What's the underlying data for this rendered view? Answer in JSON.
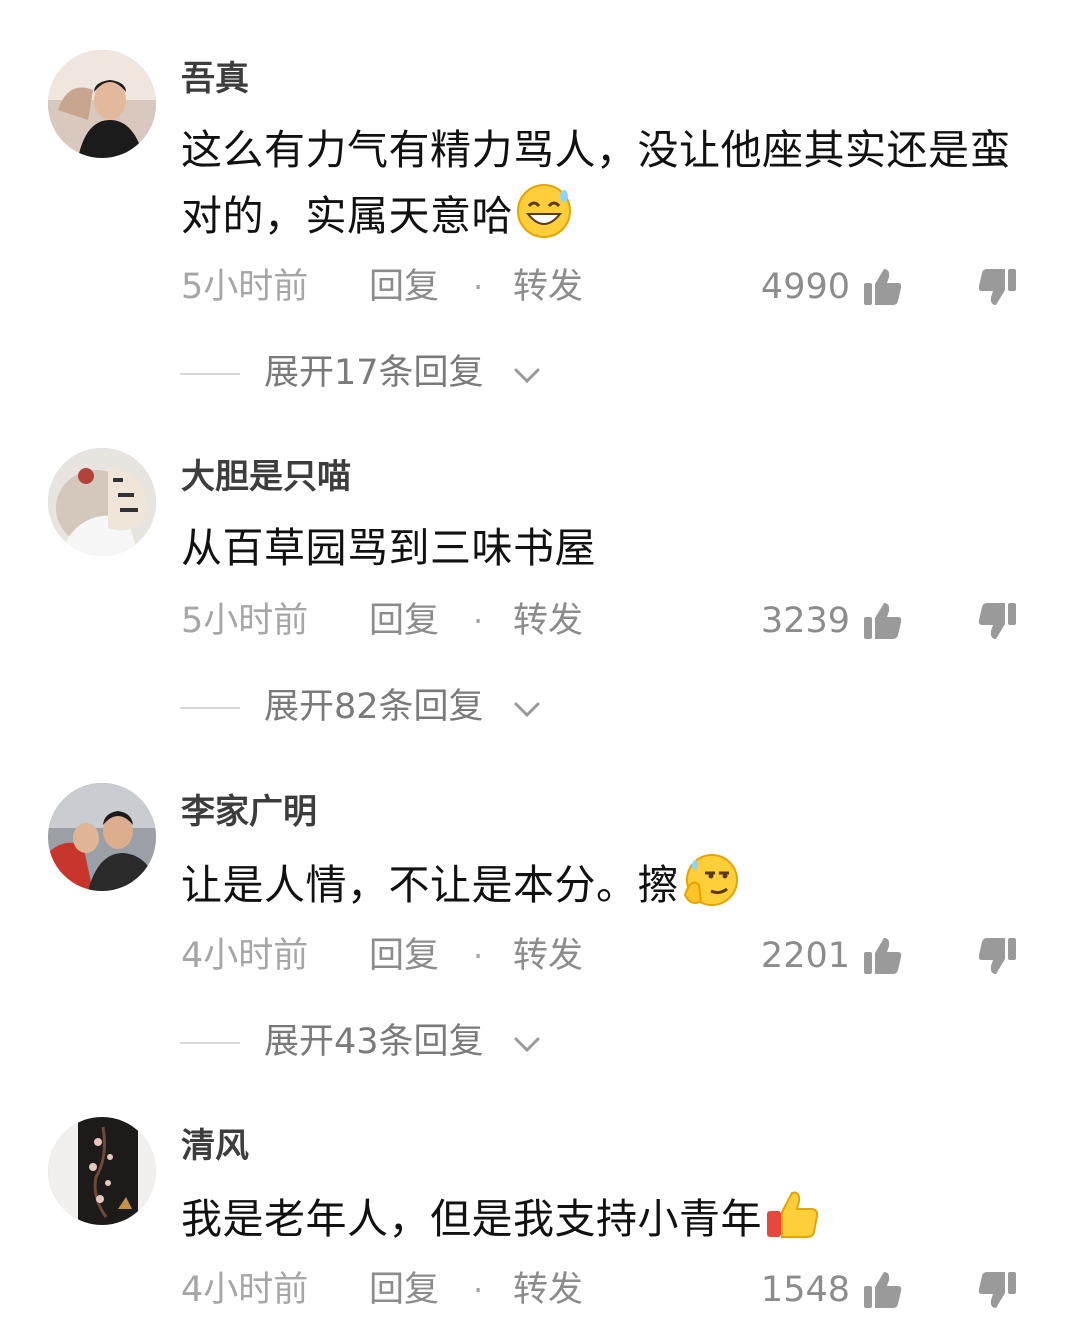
{
  "comments": [
    {
      "username": "吾真",
      "text": "这么有力气有精力骂人，没让他座其实还是蛮对的，实属天意哈",
      "emoji": "grinning-sweat-emoji",
      "time": "5小时前",
      "reply_label": "回复",
      "separator": "·",
      "share_label": "转发",
      "likes": "4990",
      "expand_label": "展开17条回复"
    },
    {
      "username": "大胆是只喵",
      "text": "从百草园骂到三味书屋",
      "emoji": "",
      "time": "5小时前",
      "reply_label": "回复",
      "separator": "·",
      "share_label": "转发",
      "likes": "3239",
      "expand_label": "展开82条回复"
    },
    {
      "username": "李家广明",
      "text": "让是人情，不让是本分。擦",
      "emoji": "smirk-wipe-emoji",
      "time": "4小时前",
      "reply_label": "回复",
      "separator": "·",
      "share_label": "转发",
      "likes": "2201",
      "expand_label": "展开43条回复"
    },
    {
      "username": "清风",
      "text": "我是老年人，但是我支持小青年",
      "emoji": "thumbs-up-emoji",
      "time": "4小时前",
      "reply_label": "回复",
      "separator": "·",
      "share_label": "转发",
      "likes": "1548",
      "expand_label": ""
    }
  ],
  "icons": {
    "like": "thumbs-up-icon",
    "dislike": "thumbs-down-icon",
    "expand": "chevron-down-icon"
  },
  "colors": {
    "text_primary": "#111111",
    "text_secondary": "#8c8c8c",
    "username": "#3d3d3d"
  }
}
